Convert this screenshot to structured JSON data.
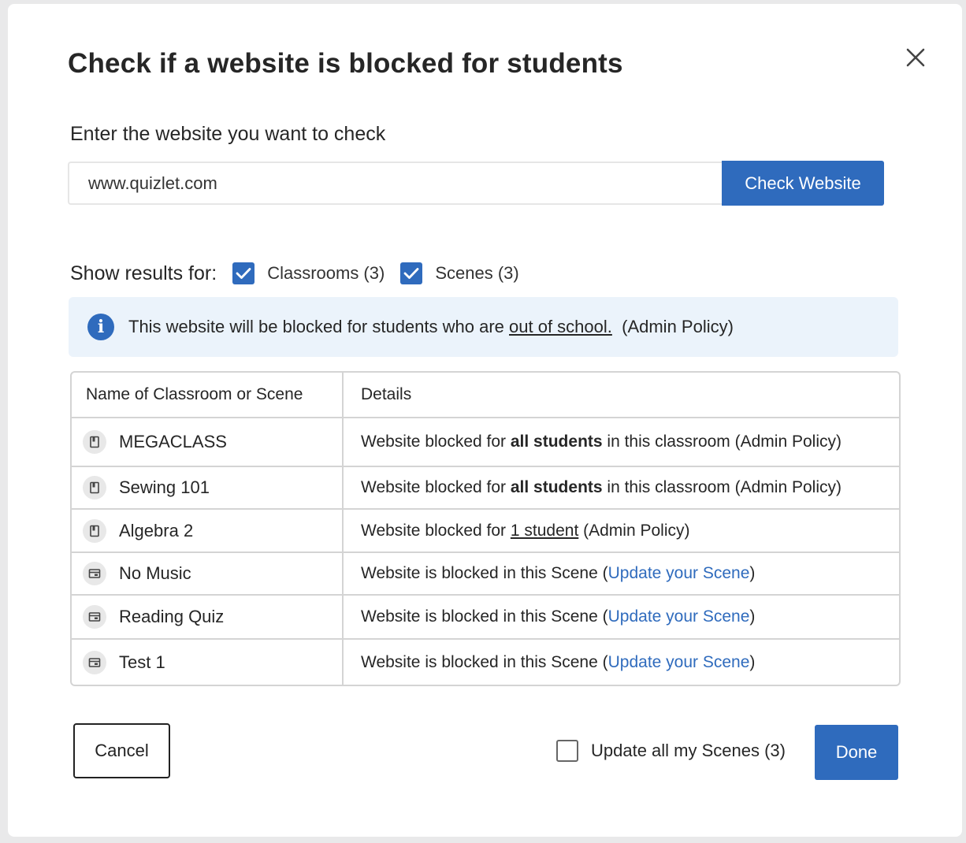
{
  "dialog": {
    "title": "Check if a website is blocked for students",
    "close_icon": "close-icon"
  },
  "check": {
    "label": "Enter the website you want to check",
    "input_value": "www.quizlet.com",
    "button_label": "Check Website"
  },
  "filters": {
    "label": "Show results for:",
    "classrooms": {
      "label": "Classrooms (3)",
      "checked": true
    },
    "scenes": {
      "label": "Scenes (3)",
      "checked": true
    }
  },
  "info": {
    "icon": "info-icon",
    "text_before": "This website will be blocked for students who are ",
    "link_text": "out of school.",
    "text_after": "  (Admin Policy)"
  },
  "table": {
    "headers": [
      "Name of Classroom or Scene",
      "Details"
    ],
    "rows": [
      {
        "icon": "classroom-icon",
        "name": "MEGACLASS",
        "pre": "Website blocked for ",
        "emph": "all students",
        "post": " in this classroom (Admin Policy)"
      },
      {
        "icon": "classroom-icon",
        "name": "Sewing 101",
        "pre": "Website blocked for ",
        "emph": "all students",
        "post": " in this classroom (Admin Policy)"
      },
      {
        "icon": "classroom-icon",
        "name": "Algebra 2",
        "pre": "Website blocked for ",
        "emph": "1 student",
        "post": " (Admin Policy)"
      },
      {
        "icon": "scene-icon",
        "name": "No Music",
        "pre": "Website is blocked in this Scene (",
        "emph": "Update your Scene",
        "post": ")"
      },
      {
        "icon": "scene-icon",
        "name": "Reading Quiz",
        "pre": "Website is blocked in this Scene (",
        "emph": "Update your Scene",
        "post": ")"
      },
      {
        "icon": "scene-icon",
        "name": "Test 1",
        "pre": "Website is blocked in this Scene (",
        "emph": "Update your Scene",
        "post": ")"
      }
    ]
  },
  "footer": {
    "cancel_label": "Cancel",
    "update_all": {
      "label": "Update all my Scenes (3)",
      "checked": false
    },
    "done_label": "Done"
  },
  "colors": {
    "primary": "#2f6bbd",
    "info_bg": "#ebf3fb"
  }
}
